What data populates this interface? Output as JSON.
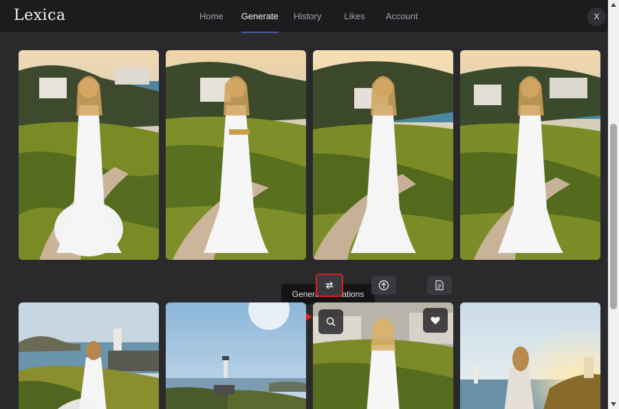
{
  "app": {
    "logo": "Lexica"
  },
  "nav": {
    "items": [
      {
        "label": "Home",
        "active": false
      },
      {
        "label": "Generate",
        "active": true
      },
      {
        "label": "History",
        "active": false
      },
      {
        "label": "Likes",
        "active": false
      },
      {
        "label": "Account",
        "active": false
      }
    ]
  },
  "close_label": "X",
  "tooltip": "Generate variations",
  "actions": {
    "variations_icon": "repeat-arrows-icon",
    "upscale_icon": "arrow-up-circle-icon",
    "prompt_icon": "document-icon"
  },
  "overlay": {
    "search_icon": "search-icon",
    "like_icon": "heart-icon"
  },
  "colors": {
    "accent": "#3f5f9a",
    "highlight": "#e11d22",
    "background": "#2a2a2c",
    "header": "#1c1c1e"
  }
}
